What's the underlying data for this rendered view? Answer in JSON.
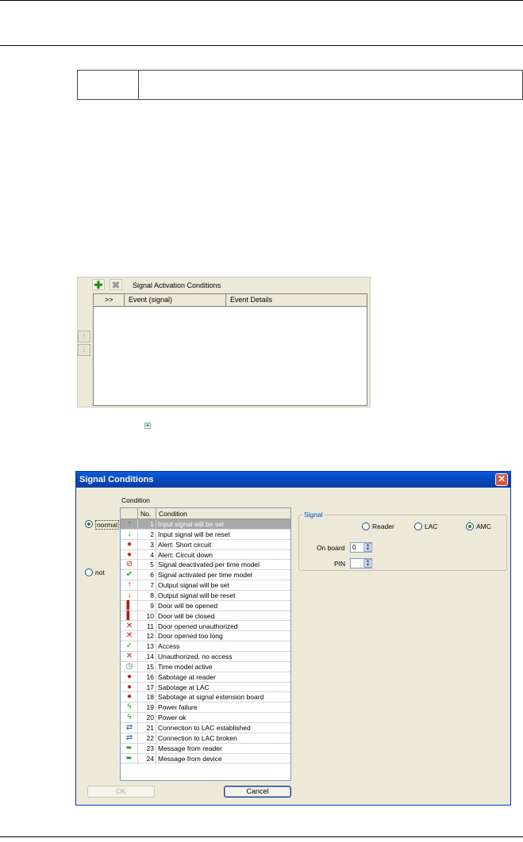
{
  "panel": {
    "title": "Signal Activation Conditions",
    "columns": [
      ">>",
      "Event (signal)",
      "Event Details"
    ]
  },
  "dialog": {
    "title": "Signal Conditions",
    "condition_group_label": "Condition",
    "radio_normal": "normal",
    "radio_not": "not",
    "table_headers": [
      "No.",
      "Condition"
    ],
    "rows": [
      {
        "icon": "arrow-up-icon",
        "glyph": "↑",
        "color": "#2a9a2a",
        "no": "1",
        "text": "Input signal will be set",
        "selected": true
      },
      {
        "icon": "arrow-down-icon",
        "glyph": "↓",
        "color": "#2a9a2a",
        "no": "2",
        "text": "Input signal will be reset"
      },
      {
        "icon": "alert-short-icon",
        "glyph": "●",
        "color": "#d02020",
        "no": "3",
        "text": "Alert: Short circuit"
      },
      {
        "icon": "alert-down-icon",
        "glyph": "●",
        "color": "#d02020",
        "no": "4",
        "text": "Alert: Circuit down"
      },
      {
        "icon": "deactivated-icon",
        "glyph": "⊘",
        "color": "#d02020",
        "no": "5",
        "text": "Signal deactivated per time model"
      },
      {
        "icon": "activated-icon",
        "glyph": "✔",
        "color": "#2a9a2a",
        "no": "6",
        "text": "Signal activated per time model"
      },
      {
        "icon": "output-set-icon",
        "glyph": "↑",
        "color": "#d02020",
        "no": "7",
        "text": "Output signal will be set"
      },
      {
        "icon": "output-reset-icon",
        "glyph": "↓",
        "color": "#d02020",
        "no": "8",
        "text": "Output signal will be reset"
      },
      {
        "icon": "door-open-icon",
        "glyph": "▌",
        "color": "#c01010",
        "no": "9",
        "text": "Door will be opened"
      },
      {
        "icon": "door-closed-icon",
        "glyph": "▌",
        "color": "#c01010",
        "no": "10",
        "text": "Door will be closed"
      },
      {
        "icon": "door-unauthorized-icon",
        "glyph": "✕",
        "color": "#c01010",
        "no": "11",
        "text": "Door opened unauthorized"
      },
      {
        "icon": "door-too-long-icon",
        "glyph": "✕",
        "color": "#c01010",
        "no": "12",
        "text": "Door opened too long"
      },
      {
        "icon": "access-icon",
        "glyph": "✓",
        "color": "#2a9a2a",
        "no": "13",
        "text": "Access"
      },
      {
        "icon": "no-access-icon",
        "glyph": "✕",
        "color": "#d02020",
        "no": "14",
        "text": "Unauthorized, no access"
      },
      {
        "icon": "clock-icon",
        "glyph": "◷",
        "color": "#4a6aa0",
        "no": "15",
        "text": "Time model active"
      },
      {
        "icon": "sabotage-reader-icon",
        "glyph": "●",
        "color": "#d02020",
        "no": "16",
        "text": "Sabotage at reader"
      },
      {
        "icon": "sabotage-lac-icon",
        "glyph": "●",
        "color": "#d02020",
        "no": "17",
        "text": "Sabotage at LAC"
      },
      {
        "icon": "sabotage-board-icon",
        "glyph": "●",
        "color": "#d02020",
        "no": "18",
        "text": "Sabotage at signal extension board"
      },
      {
        "icon": "power-failure-icon",
        "glyph": "ϟ",
        "color": "#2a9a2a",
        "no": "19",
        "text": "Power failure"
      },
      {
        "icon": "power-ok-icon",
        "glyph": "ϟ",
        "color": "#2a9a2a",
        "no": "20",
        "text": "Power ok"
      },
      {
        "icon": "connection-established-icon",
        "glyph": "⇄",
        "color": "#2a5aa0",
        "no": "21",
        "text": "Connection to LAC established"
      },
      {
        "icon": "connection-broken-icon",
        "glyph": "⇄",
        "color": "#2a5aa0",
        "no": "22",
        "text": "Connection to LAC broken"
      },
      {
        "icon": "message-reader-icon",
        "glyph": "➨",
        "color": "#2a9a2a",
        "no": "23",
        "text": "Message from reader"
      },
      {
        "icon": "message-device-icon",
        "glyph": "➨",
        "color": "#2a9a2a",
        "no": "24",
        "text": "Message from device"
      }
    ],
    "signal_group_label": "Signal",
    "signal_options": [
      "Reader",
      "LAC",
      "AMC"
    ],
    "signal_selected": "AMC",
    "onboard_label": "On board",
    "onboard_value": "0",
    "pin_label": "PIN",
    "pin_value": "",
    "ok_label": "OK",
    "cancel_label": "Cancel"
  }
}
